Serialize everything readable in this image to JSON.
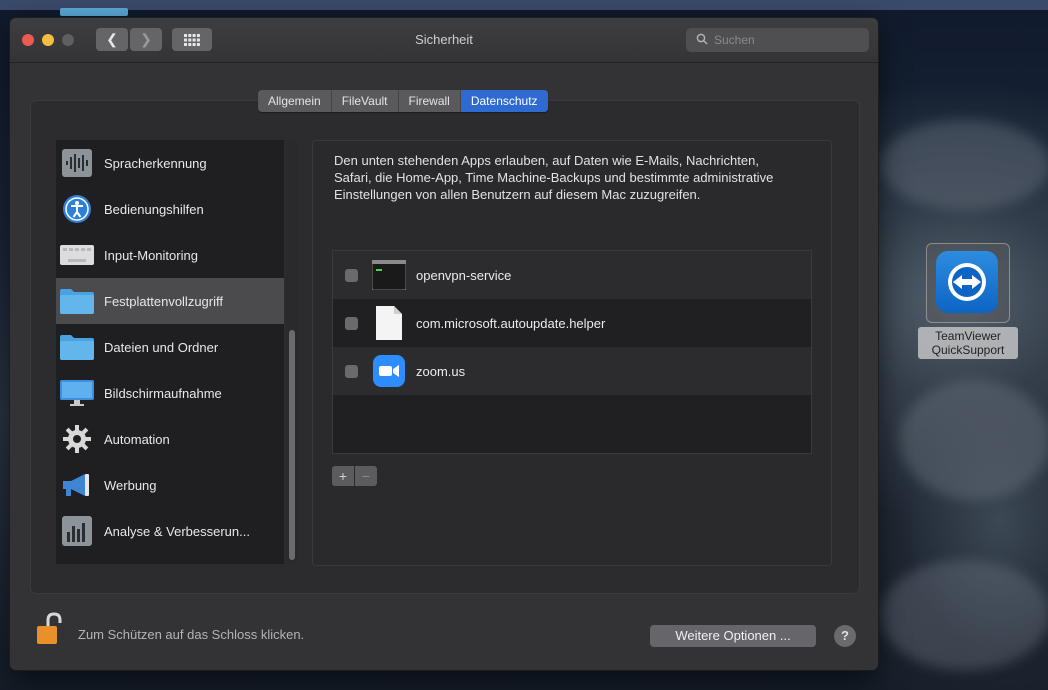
{
  "window": {
    "title": "Sicherheit",
    "search_placeholder": "Suchen"
  },
  "tabs": [
    {
      "label": "Allgemein",
      "active": false
    },
    {
      "label": "FileVault",
      "active": false
    },
    {
      "label": "Firewall",
      "active": false
    },
    {
      "label": "Datenschutz",
      "active": true
    }
  ],
  "sidebar": {
    "items": [
      {
        "label": "Spracherkennung",
        "icon": "waveform-icon"
      },
      {
        "label": "Bedienungshilfen",
        "icon": "accessibility-icon"
      },
      {
        "label": "Input-Monitoring",
        "icon": "keyboard-icon"
      },
      {
        "label": "Festplattenvollzugriff",
        "icon": "folder-icon",
        "selected": true
      },
      {
        "label": "Dateien und Ordner",
        "icon": "folder-icon"
      },
      {
        "label": "Bildschirmaufnahme",
        "icon": "display-icon"
      },
      {
        "label": "Automation",
        "icon": "gear-icon"
      },
      {
        "label": "Werbung",
        "icon": "megaphone-icon"
      },
      {
        "label": "Analyse & Verbesserun...",
        "icon": "bar-chart-icon"
      }
    ]
  },
  "main": {
    "description": "Den unten stehenden Apps erlauben, auf Daten wie E-Mails, Nachrichten, Safari, die Home-App, Time Machine-Backups und bestimmte administrative Einstellungen von allen Benutzern auf diesem Mac zuzugreifen.",
    "apps": [
      {
        "name": "openvpn-service",
        "icon": "terminal-icon",
        "checked": false
      },
      {
        "name": "com.microsoft.autoupdate.helper",
        "icon": "document-icon",
        "checked": false
      },
      {
        "name": "zoom.us",
        "icon": "zoom-icon",
        "checked": false
      }
    ],
    "add_label": "+",
    "remove_label": "−"
  },
  "footer": {
    "lock_text": "Zum Schützen auf das Schloss klicken.",
    "more_options_label": "Weitere Optionen ...",
    "help_label": "?"
  },
  "desktop": {
    "icon_label_line1": "TeamViewer",
    "icon_label_line2": "QuickSupport"
  },
  "colors": {
    "accent": "#2f6ad0",
    "lock": "#e8902a",
    "folder": "#4aa3e0"
  }
}
